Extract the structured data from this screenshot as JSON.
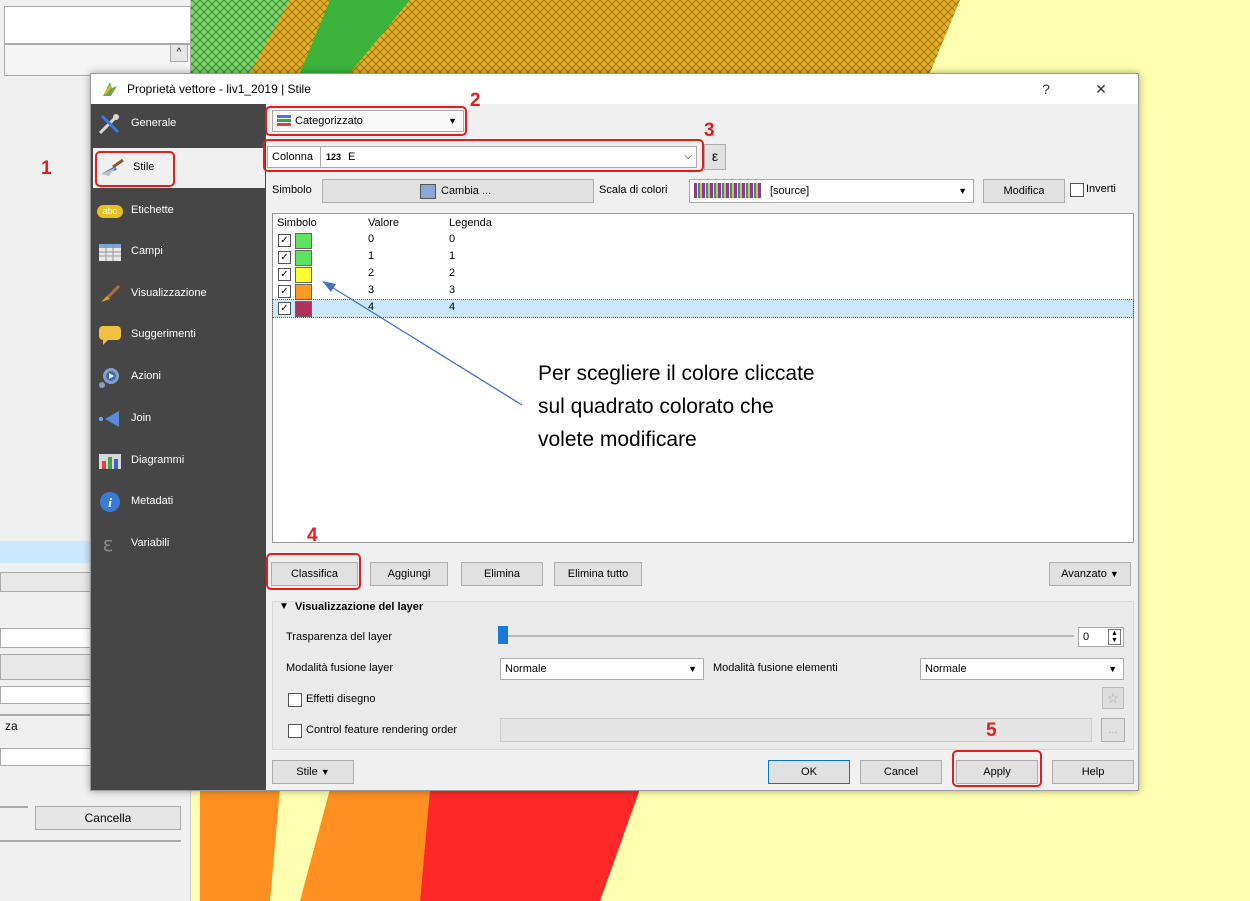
{
  "background": {
    "cancel_label": "Cancella",
    "partial_label": "za"
  },
  "dialog": {
    "title": "Proprietà vettore - liv1_2019 | Stile",
    "help_label": "?",
    "close_label": "✕",
    "sidebar": [
      {
        "label": "Generale",
        "icon": "tools-icon"
      },
      {
        "label": "Stile",
        "icon": "paintbrush-icon"
      },
      {
        "label": "Etichette",
        "icon": "abc-label-icon"
      },
      {
        "label": "Campi",
        "icon": "table-icon"
      },
      {
        "label": "Visualizzazione",
        "icon": "brush-icon"
      },
      {
        "label": "Suggerimenti",
        "icon": "speech-bubble-icon"
      },
      {
        "label": "Azioni",
        "icon": "gear-play-icon"
      },
      {
        "label": "Join",
        "icon": "join-arrow-icon"
      },
      {
        "label": "Diagrammi",
        "icon": "chart-icon"
      },
      {
        "label": "Metadati",
        "icon": "info-icon"
      },
      {
        "label": "Variabili",
        "icon": "epsilon-icon"
      }
    ],
    "renderer": "Categorizzato",
    "column_label": "Colonna",
    "column_type": "123",
    "column_value": "E",
    "epsilon": "ε",
    "symbol_label": "Simbolo",
    "change_label": "Cambia ...",
    "color_ramp_label": "Scala di colori",
    "color_ramp_value": "[source]",
    "modify_label": "Modifica",
    "invert_label": "Inverti",
    "table": {
      "headers": [
        "Simbolo",
        "Valore",
        "Legenda"
      ],
      "rows": [
        {
          "value": "0",
          "legend": "0",
          "color": "#5ee35e"
        },
        {
          "value": "1",
          "legend": "1",
          "color": "#5ee35e"
        },
        {
          "value": "2",
          "legend": "2",
          "color": "#ffff33"
        },
        {
          "value": "3",
          "legend": "3",
          "color": "#ff9922"
        },
        {
          "value": "4",
          "legend": "4",
          "color": "#b03060"
        }
      ]
    },
    "buttons": {
      "classify": "Classifica",
      "add": "Aggiungi",
      "delete": "Elimina",
      "delete_all": "Elimina tutto",
      "advanced": "Avanzato"
    },
    "layer_rendering": {
      "section_title": "Visualizzazione del layer",
      "transparency_label": "Trasparenza del layer",
      "transparency_value": "0",
      "layer_blend_label": "Modalità fusione layer",
      "layer_blend_value": "Normale",
      "feature_blend_label": "Modalità fusione elementi",
      "feature_blend_value": "Normale",
      "effects_label": "Effetti disegno",
      "order_label": "Control feature rendering order",
      "dots": "..."
    },
    "footer": {
      "style": "Stile",
      "ok": "OK",
      "cancel": "Cancel",
      "apply": "Apply",
      "help": "Help"
    }
  },
  "annotations": {
    "step1": "1",
    "step2": "2",
    "step3": "3",
    "step4": "4",
    "step5": "5",
    "note_line1": "Per scegliere il colore cliccate",
    "note_line2": "sul quadrato colorato che",
    "note_line3": "volete modificare"
  },
  "colors": {
    "accent_red": "#e02020",
    "sidebar_bg": "#464646",
    "selected_row": "#cce8ff"
  }
}
